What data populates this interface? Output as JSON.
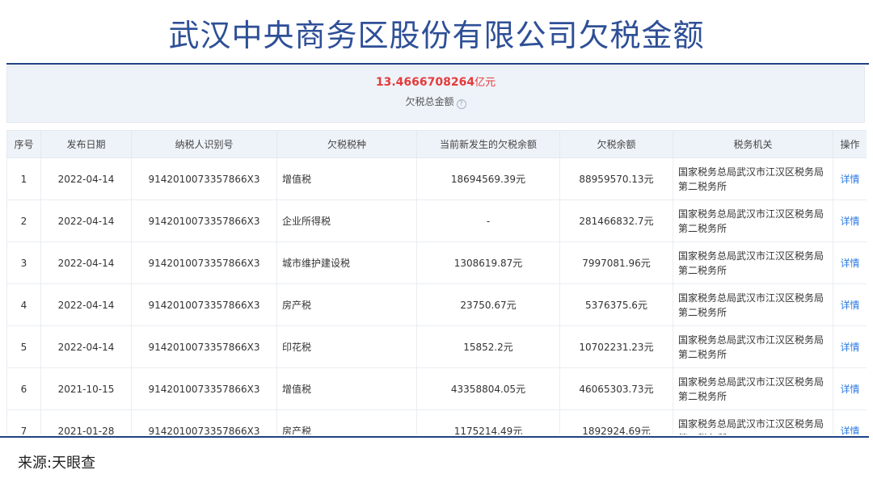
{
  "title": "武汉中央商务区股份有限公司欠税金额",
  "summary": {
    "amount": "13.4666708264",
    "unit": "亿元",
    "label": "欠税总金额"
  },
  "table": {
    "headers": [
      "序号",
      "发布日期",
      "纳税人识别号",
      "欠税税种",
      "当前新发生的欠税余额",
      "欠税余额",
      "税务机关",
      "操作"
    ],
    "rows": [
      {
        "no": "1",
        "date": "2022-04-14",
        "tax_id": "9142010073357866X3",
        "tax_type": "增值税",
        "new_balance": "18694569.39元",
        "balance": "88959570.13元",
        "office": "国家税务总局武汉市江汉区税务局第二税务所",
        "action": "详情"
      },
      {
        "no": "2",
        "date": "2022-04-14",
        "tax_id": "9142010073357866X3",
        "tax_type": "企业所得税",
        "new_balance": "-",
        "balance": "281466832.7元",
        "office": "国家税务总局武汉市江汉区税务局第二税务所",
        "action": "详情"
      },
      {
        "no": "3",
        "date": "2022-04-14",
        "tax_id": "9142010073357866X3",
        "tax_type": "城市维护建设税",
        "new_balance": "1308619.87元",
        "balance": "7997081.96元",
        "office": "国家税务总局武汉市江汉区税务局第二税务所",
        "action": "详情"
      },
      {
        "no": "4",
        "date": "2022-04-14",
        "tax_id": "9142010073357866X3",
        "tax_type": "房产税",
        "new_balance": "23750.67元",
        "balance": "5376375.6元",
        "office": "国家税务总局武汉市江汉区税务局第二税务所",
        "action": "详情"
      },
      {
        "no": "5",
        "date": "2022-04-14",
        "tax_id": "9142010073357866X3",
        "tax_type": "印花税",
        "new_balance": "15852.2元",
        "balance": "10702231.23元",
        "office": "国家税务总局武汉市江汉区税务局第二税务所",
        "action": "详情"
      },
      {
        "no": "6",
        "date": "2021-10-15",
        "tax_id": "9142010073357866X3",
        "tax_type": "增值税",
        "new_balance": "43358804.05元",
        "balance": "46065303.73元",
        "office": "国家税务总局武汉市江汉区税务局第二税务所",
        "action": "详情"
      },
      {
        "no": "7",
        "date": "2021-01-28",
        "tax_id": "9142010073357866X3",
        "tax_type": "房产税",
        "new_balance": "1175214.49元",
        "balance": "1892924.69元",
        "office": "国家税务总局武汉市江汉区税务局第二税务所",
        "action": "详情"
      }
    ]
  },
  "source": "来源:天眼查",
  "colors": {
    "title": "#2e4f97",
    "rule": "#1f4185",
    "amount": "#e43b3b",
    "link": "#2c7be5",
    "header_bg": "#eef3f9"
  },
  "icons": [
    "question-circle-icon"
  ]
}
